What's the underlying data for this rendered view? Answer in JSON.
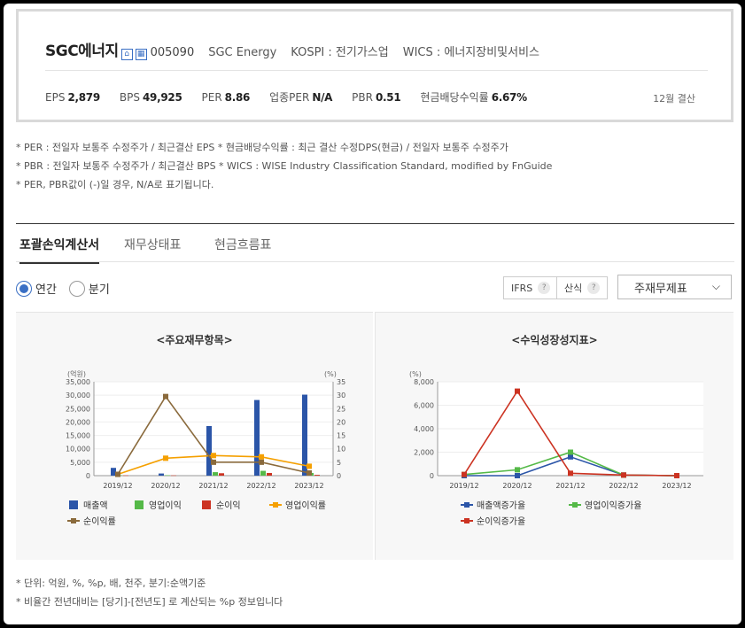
{
  "company": {
    "name": "SGC에너지",
    "code": "005090",
    "english_name": "SGC Energy",
    "market": "KOSPI : 전기가스업",
    "wics": "WICS : 에너지장비및서비스",
    "icons": [
      "home-icon",
      "building-icon"
    ]
  },
  "metrics": [
    {
      "label": "EPS",
      "value": "2,879"
    },
    {
      "label": "BPS",
      "value": "49,925"
    },
    {
      "label": "PER",
      "value": "8.86"
    },
    {
      "label": "업종PER",
      "value": "N/A"
    },
    {
      "label": "PBR",
      "value": "0.51"
    },
    {
      "label": "현금배당수익률",
      "value": "6.67%"
    }
  ],
  "settlement": "12월 결산",
  "notes": [
    "* PER : 전일자 보통주 수정주가 / 최근결산 EPS * 현금배당수익률 : 최근 결산 수정DPS(현금) / 전일자 보통주 수정주가",
    "* PBR : 전일자 보통주 수정주가 / 최근결산 BPS * WICS : WISE Industry Classification Standard, modified by FnGuide",
    "* PER, PBR값이 (-)일 경우, N/A로 표기됩니다."
  ],
  "tabs": [
    "포괄손익계산서",
    "재무상태표",
    "현금흐름표"
  ],
  "period_options": [
    "연간",
    "분기"
  ],
  "selected_period": "연간",
  "toggles": [
    {
      "label": "IFRS",
      "help": "?"
    },
    {
      "label": "산식",
      "help": "?"
    }
  ],
  "select": {
    "label": "주재무제표",
    "icon": "chevron-down-icon"
  },
  "unit_notes": [
    "* 단위: 억원, %, %p, 배, 천주, 분기:순액기준",
    "* 비율간 전년대비는 [당기]-[전년도] 로 계산되는 %p 정보입니다"
  ],
  "colors": {
    "blue": "#2b55a8",
    "green": "#55b948",
    "red": "#cc3322",
    "orange": "#f5a000",
    "brown": "#8a6a3c"
  },
  "chart_data": [
    {
      "type": "bar+line",
      "title": "<주요재무항목>",
      "categories": [
        "2019/12",
        "2020/12",
        "2021/12",
        "2022/12",
        "2023/12"
      ],
      "y_left_label": "(억원)",
      "y_right_label": "(%)",
      "ylim_left": [
        0,
        35000
      ],
      "ylim_right": [
        0,
        35
      ],
      "yticks_left": [
        "0",
        "5,000",
        "10,000",
        "15,000",
        "20,000",
        "25,000",
        "30,000",
        "35,000"
      ],
      "yticks_right": [
        "0",
        "5",
        "10",
        "15",
        "20",
        "25",
        "30",
        "35"
      ],
      "bars": [
        {
          "name": "매출액",
          "color": "#2b55a8",
          "values": [
            2900,
            800,
            18500,
            28200,
            30200
          ]
        },
        {
          "name": "영업이익",
          "color": "#55b948",
          "values": [
            150,
            150,
            1300,
            1800,
            1000
          ]
        },
        {
          "name": "순이익",
          "color": "#cc3322",
          "values": [
            100,
            100,
            900,
            1000,
            300
          ]
        }
      ],
      "lines": [
        {
          "name": "영업이익률",
          "color": "#f5a000",
          "values": [
            0.5,
            6.5,
            7.5,
            7.0,
            3.5
          ]
        },
        {
          "name": "순이익률",
          "color": "#8a6a3c",
          "values": [
            0.5,
            29.5,
            5.0,
            5.0,
            1.0
          ]
        }
      ],
      "legend": [
        "매출액",
        "영업이익",
        "순이익",
        "영업이익률",
        "순이익률"
      ]
    },
    {
      "type": "line",
      "title": "<수익성장성지표>",
      "categories": [
        "2019/12",
        "2020/12",
        "2021/12",
        "2022/12",
        "2023/12"
      ],
      "y_label": "(%)",
      "ylim": [
        0,
        8000
      ],
      "yticks": [
        "0",
        "2,000",
        "4,000",
        "6,000",
        "8,000"
      ],
      "series": [
        {
          "name": "매출액증가율",
          "color": "#2b55a8",
          "values": [
            0,
            0,
            1600,
            50,
            0
          ]
        },
        {
          "name": "영업이익증가율",
          "color": "#55b948",
          "values": [
            100,
            500,
            2000,
            50,
            0
          ]
        },
        {
          "name": "순이익증가율",
          "color": "#cc3322",
          "values": [
            100,
            7200,
            200,
            50,
            0
          ]
        }
      ],
      "legend": [
        "매출액증가율",
        "영업이익증가율",
        "순이익증가율"
      ]
    }
  ]
}
